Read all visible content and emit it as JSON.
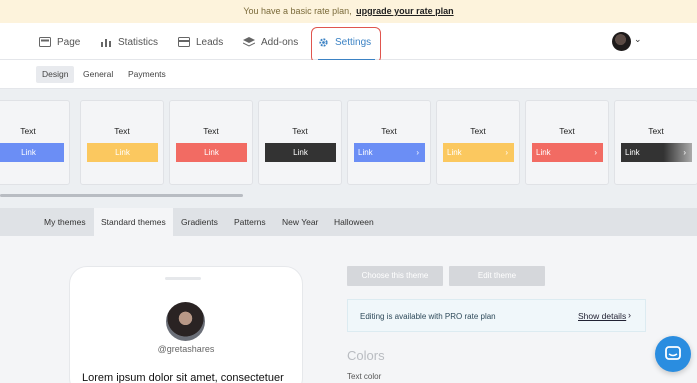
{
  "banner": {
    "text": "You have a basic rate plan,",
    "link": "upgrade your rate plan"
  },
  "nav": {
    "page": "Page",
    "statistics": "Statistics",
    "leads": "Leads",
    "addons": "Add-ons",
    "settings": "Settings"
  },
  "subnav": {
    "design": "Design",
    "general": "General",
    "payments": "Payments"
  },
  "cards": [
    {
      "text": "Text",
      "link": "Link",
      "color": "#6b8ef5"
    },
    {
      "text": "Text",
      "link": "Link",
      "color": "#fbc85f"
    },
    {
      "text": "Text",
      "link": "Link",
      "color": "#f26b63"
    },
    {
      "text": "Text",
      "link": "Link",
      "color": "#333333"
    },
    {
      "text": "Text",
      "link": "Link",
      "color": "#6b8ef5"
    },
    {
      "text": "Text",
      "link": "Link",
      "color": "#fbc85f"
    },
    {
      "text": "Text",
      "link": "Link",
      "color": "#f26b63"
    },
    {
      "text": "Text",
      "link": "Link",
      "color": "#333333"
    }
  ],
  "theme_tabs": {
    "my_themes": "My themes",
    "standard": "Standard themes",
    "gradients": "Gradients",
    "patterns": "Patterns",
    "new_year": "New Year",
    "halloween": "Halloween"
  },
  "preview": {
    "handle": "@gretashares",
    "lorem": "Lorem ipsum dolor sit amet, consectetuer"
  },
  "actions": {
    "choose": "Choose this theme",
    "edit": "Edit theme"
  },
  "pro": {
    "text": "Editing is available with PRO rate plan",
    "link": "Show details"
  },
  "colors": {
    "title": "Colors",
    "text_color": "Text color"
  },
  "accent": "#3b82c4"
}
